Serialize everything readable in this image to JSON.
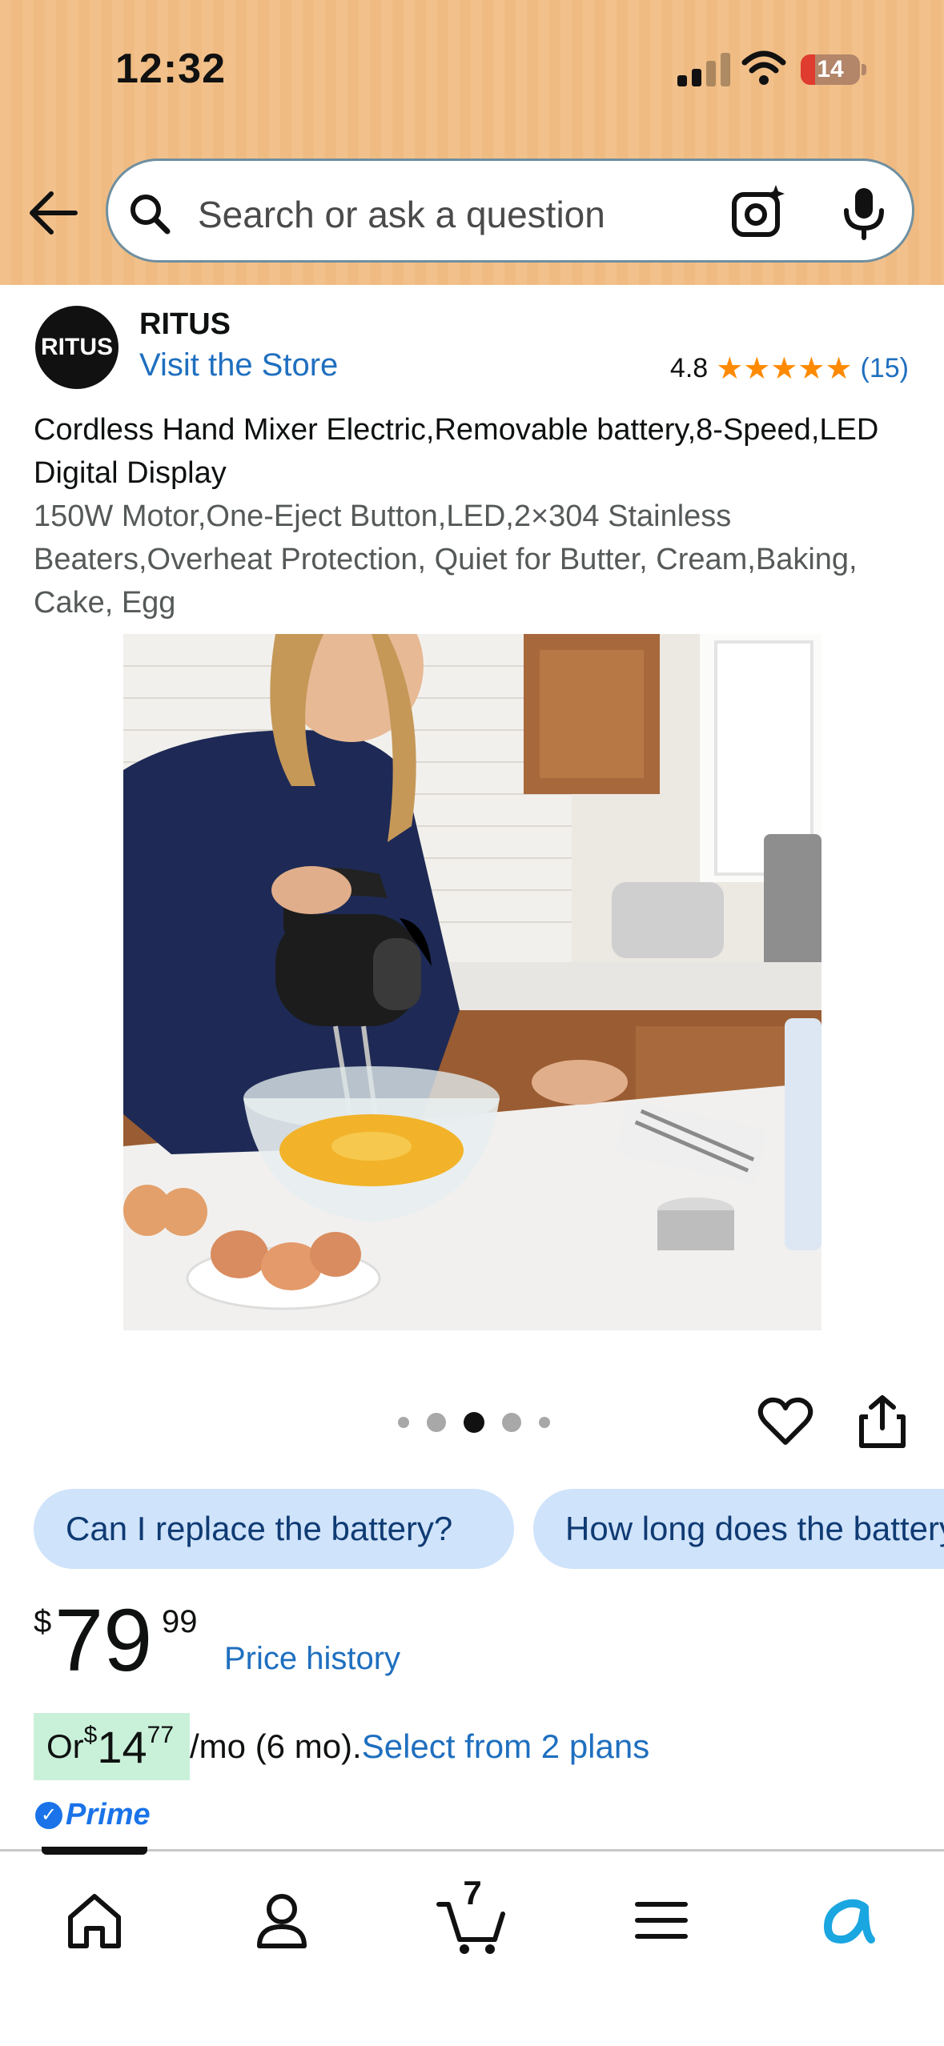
{
  "status_bar": {
    "time": "12:32",
    "battery": "14"
  },
  "search": {
    "placeholder": "Search or ask a question"
  },
  "brand": {
    "logo_text": "RITUS",
    "name": "RITUS",
    "visit_store": "Visit the Store",
    "rating": "4.8",
    "stars": "★★★★★",
    "review_count": "(15)"
  },
  "product": {
    "title": "Cordless Hand Mixer Electric,Removable battery,8-Speed,LED Digital Display",
    "subtitle": "150W Motor,One-Eject Button,LED,2×304 Stainless Beaters,Overheat Protection, Quiet for Butter, Cream,Baking, Cake, Egg",
    "image_alt": "Woman using cordless hand mixer in kitchen",
    "image_count": 5,
    "active_image_index": 2
  },
  "questions": [
    "Can I replace the battery?",
    "How long does the battery last?"
  ],
  "price": {
    "symbol": "$",
    "whole": "79",
    "fraction": "99",
    "history_link": "Price history"
  },
  "installment": {
    "prefix": "Or ",
    "symbol": "$",
    "whole": "14",
    "fraction": "77",
    "suffix": "/mo (6 mo).",
    "link": "Select from 2 plans"
  },
  "prime": {
    "label": "Prime"
  },
  "nav": {
    "cart_count": "7",
    "items": [
      "home-icon",
      "account-icon",
      "cart-icon",
      "menu-icon",
      "rufus-ai-icon"
    ]
  },
  "colors": {
    "header_bg": "#f2c18b",
    "link": "#1f6fbf",
    "star": "#ff8a00",
    "chip_bg": "#cfe3fb",
    "installment_highlight": "#c9f1d9",
    "prime": "#1a73e8"
  }
}
